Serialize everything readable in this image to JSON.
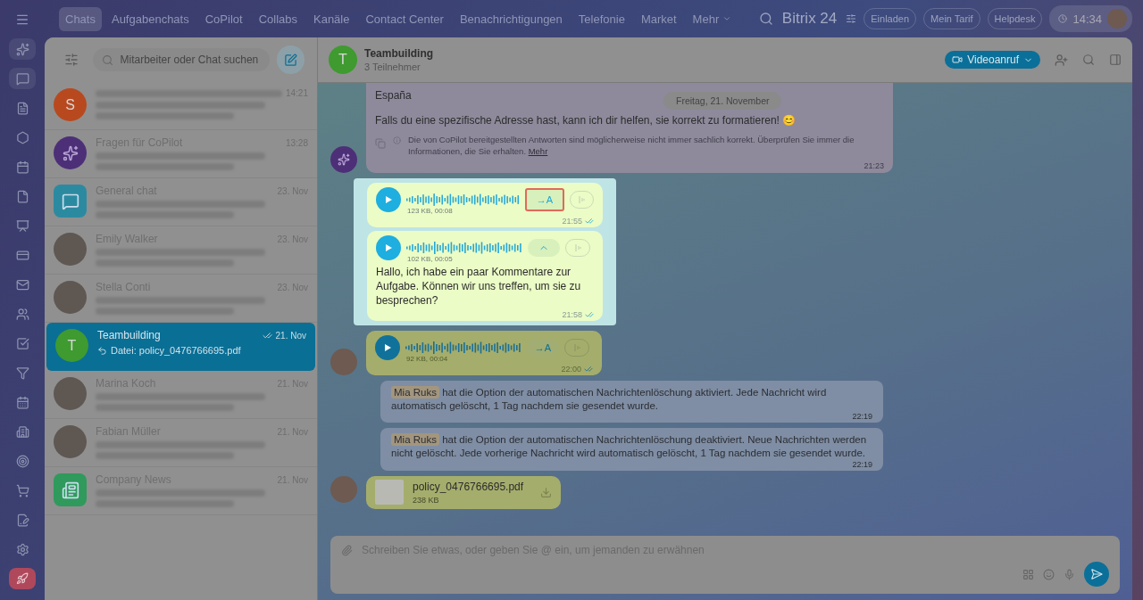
{
  "top_nav": {
    "tabs": [
      {
        "label": "Chats",
        "selected": true
      },
      {
        "label": "Aufgabenchats",
        "selected": false
      },
      {
        "label": "CoPilot",
        "selected": false
      },
      {
        "label": "Collabs",
        "selected": false
      },
      {
        "label": "Kanäle",
        "selected": false
      },
      {
        "label": "Contact Center",
        "selected": false
      },
      {
        "label": "Benachrichtigungen",
        "selected": false
      },
      {
        "label": "Telefonie",
        "selected": false
      },
      {
        "label": "Market",
        "selected": false
      }
    ],
    "more": "Mehr",
    "brand": "Bitrix 24",
    "buttons": [
      "Einladen",
      "Mein Tarif",
      "Helpdesk"
    ],
    "clock": "14:34"
  },
  "sidebar": {
    "search_placeholder": "Mitarbeiter oder Chat suchen",
    "chats": [
      {
        "kind": "letter",
        "initial": "S",
        "color": "#b8491f",
        "time": "14:21",
        "selected": false
      },
      {
        "kind": "copilot",
        "name": "Fragen für CoPilot",
        "time": "13:28",
        "selected": false
      },
      {
        "kind": "chat-app",
        "name": "General chat",
        "time": "23. Nov",
        "selected": false
      },
      {
        "kind": "photo",
        "name": "Emily Walker",
        "time": "23. Nov",
        "selected": false
      },
      {
        "kind": "photo",
        "name": "Stella Conti",
        "time": "23. Nov",
        "selected": false
      },
      {
        "kind": "letter",
        "initial": "T",
        "color": "#3f9a30",
        "name": "Teambuilding",
        "preview": "Datei: policy_0476766695.pdf",
        "time": "21. Nov",
        "selected": true,
        "read": true
      },
      {
        "kind": "photo",
        "name": "Marina Koch",
        "time": "21. Nov",
        "selected": false
      },
      {
        "kind": "photo",
        "name": "Fabian Müller",
        "time": "21. Nov",
        "selected": false
      },
      {
        "kind": "news-app",
        "name": "Company News",
        "time": "21. Nov",
        "selected": false
      }
    ]
  },
  "chat": {
    "title": "Teambuilding",
    "initial": "T",
    "subtitle": "3 Teilnehmer",
    "video_button": "Videoanruf",
    "date_badge": "Freitag, 21. November",
    "messages": [
      {
        "kind": "bot",
        "lines": [
          "España",
          "Falls du eine spezifische Adresse hast, kann ich dir helfen, sie korrekt zu formatieren! 😊"
        ],
        "disclaimer": "Die von CoPilot bereitgestellten Antworten sind möglicherweise nicht immer sachlich korrekt. Überprüfen Sie immer die Informationen, die Sie erhalten.",
        "link": "Mehr",
        "time": "21:23"
      },
      {
        "kind": "voice",
        "size": "123 KB, 00:08",
        "time": "21:55",
        "highlighted": true,
        "marked": true,
        "transcript_open": false,
        "transcribe_label": "→A",
        "read": true
      },
      {
        "kind": "voice",
        "size": "102 KB, 00:05",
        "time": "21:58",
        "highlighted": true,
        "transcript_open": true,
        "transcript": "Hallo, ich habe ein paar Kommentare zur Aufgabe. Können wir uns treffen, um sie zu besprechen?",
        "read": true
      },
      {
        "kind": "voice",
        "size": "92 KB, 00:04",
        "time": "22:00",
        "highlighted": false,
        "marked": false,
        "transcript_open": false,
        "transcribe_label": "→A",
        "read": true,
        "avatar": true
      },
      {
        "kind": "system",
        "name": "Mia Ruks",
        "text": "hat die Option der automatischen Nachrichtenlöschung aktiviert. Jede Nachricht wird automatisch gelöscht, 1 Tag nachdem sie gesendet wurde.",
        "time": "22:19"
      },
      {
        "kind": "system",
        "name": "Mia Ruks",
        "text": "hat die Option der automatischen Nachrichtenlöschung deaktiviert. Neue Nachrichten werden nicht gelöscht. Jede vorherige Nachricht wird automatisch gelöscht, 1 Tag nachdem sie gesendet wurde.",
        "time": "22:19"
      },
      {
        "kind": "file",
        "name": "policy_0476766695.pdf",
        "size": "238 KB",
        "avatar": true
      }
    ]
  },
  "composer": {
    "placeholder": "Schreiben Sie etwas, oder geben Sie @ ein, um jemanden zu erwähnen"
  }
}
